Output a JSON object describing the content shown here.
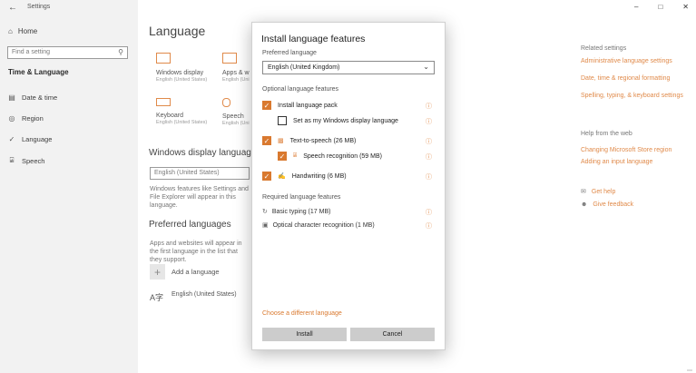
{
  "app": {
    "back_glyph": "←",
    "title": "Settings"
  },
  "window_controls": {
    "minimize": "–",
    "maximize": "□",
    "close": "✕"
  },
  "nav": {
    "home": "Home",
    "search_placeholder": "Find a setting",
    "section": "Time & Language",
    "items": [
      {
        "label": "Date & time",
        "icon": "calendar-clock-icon"
      },
      {
        "label": "Region",
        "icon": "globe-icon"
      },
      {
        "label": "Language",
        "icon": "language-icon"
      },
      {
        "label": "Speech",
        "icon": "microphone-icon"
      }
    ]
  },
  "main": {
    "title": "Language",
    "tiles": [
      {
        "label": "Windows display",
        "sub": "English (United States)"
      },
      {
        "label": "Apps & w",
        "sub": "English (Uni"
      },
      {
        "label": "Keyboard",
        "sub": "English (United States)"
      },
      {
        "label": "Speech",
        "sub": "English (Uni"
      }
    ],
    "display_heading": "Windows display language",
    "display_value": "English (United States)",
    "display_desc": "Windows features like Settings and File Explorer will appear in this language.",
    "preferred_heading": "Preferred languages",
    "preferred_desc": "Apps and websites will appear in the first language in the list that they support.",
    "add_language": "Add a language",
    "lang_entry": "English (United States)"
  },
  "right": {
    "related_heading": "Related settings",
    "related_links": [
      "Administrative language settings",
      "Date, time & regional formatting",
      "Spelling, typing, & keyboard settings"
    ],
    "help_heading": "Help from the web",
    "help_links": [
      "Changing Microsoft Store region",
      "Adding an input language"
    ],
    "get_help": "Get help",
    "give_feedback": "Give feedback"
  },
  "dialog": {
    "title": "Install language features",
    "preferred_label": "Preferred language",
    "preferred_value": "English (United Kingdom)",
    "optional_heading": "Optional language features",
    "options": [
      {
        "label": "Install language pack",
        "checked": true
      },
      {
        "label": "Set as my Windows display language",
        "checked": false
      },
      {
        "label": "Text-to-speech (26 MB)",
        "checked": true
      },
      {
        "label": "Speech recognition (59 MB)",
        "checked": true
      },
      {
        "label": "Handwriting (6 MB)",
        "checked": true
      }
    ],
    "required_heading": "Required language features",
    "required": [
      {
        "label": "Basic typing (17 MB)"
      },
      {
        "label": "Optical character recognition (1 MB)"
      }
    ],
    "choose_link": "Choose a different language",
    "install": "Install",
    "cancel": "Cancel",
    "accent": "#d9792f"
  }
}
